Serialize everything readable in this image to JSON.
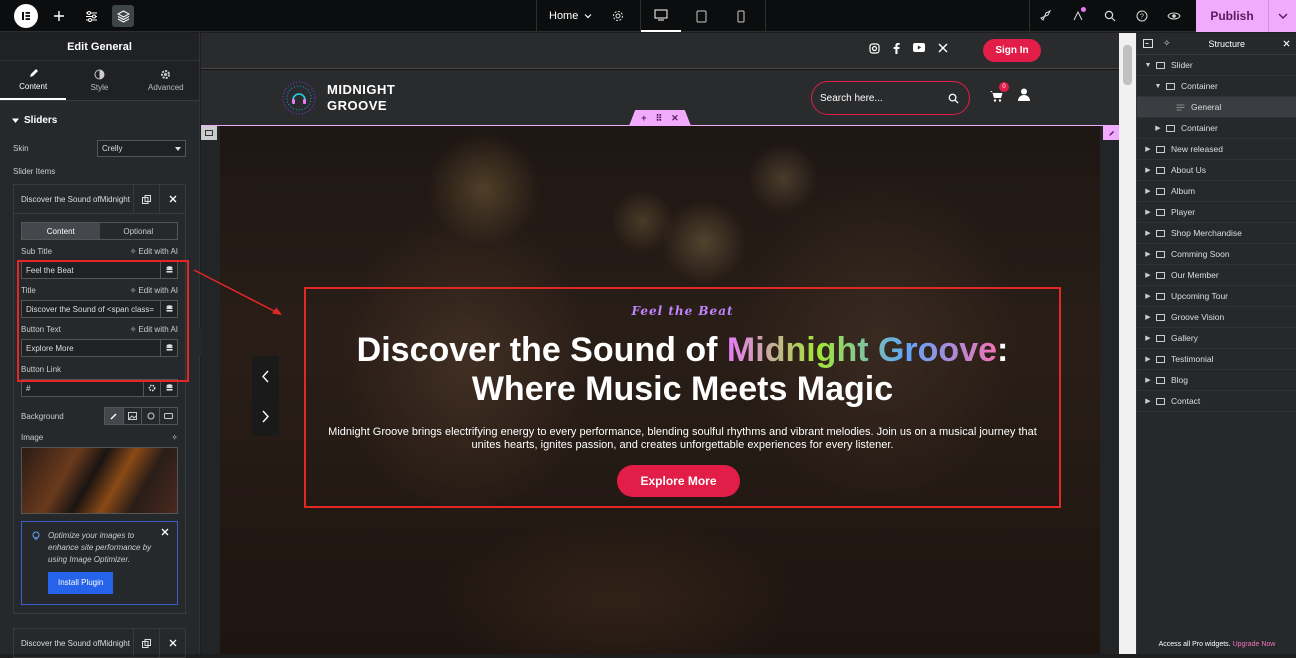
{
  "topbar": {
    "page_name": "Home",
    "publish_label": "Publish"
  },
  "left_panel": {
    "title": "Edit General",
    "tabs": [
      {
        "label": "Content"
      },
      {
        "label": "Style"
      },
      {
        "label": "Advanced"
      }
    ],
    "section_title": "Sliders",
    "skin_label": "Skin",
    "skin_value": "Crelly",
    "slider_items_label": "Slider Items",
    "item1_title": "Discover the Sound ofMidnight",
    "item_tabs": [
      "Content",
      "Optional"
    ],
    "fields": {
      "sub_title_label": "Sub Title",
      "sub_title_value": "Feel the Beat",
      "title_label": "Title",
      "title_value": "Discover the Sound of <span class=",
      "button_text_label": "Button Text",
      "button_text_value": "Explore More",
      "button_link_label": "Button Link",
      "button_link_value": "#",
      "edit_ai": "Edit with AI"
    },
    "background_label": "Background",
    "image_label": "Image",
    "notice_text": "Optimize your images to enhance site performance by using Image Optimizer.",
    "notice_button": "Install Plugin",
    "item2_title": "Discover the Sound ofMidnight"
  },
  "site": {
    "signin": "Sign In",
    "logo_line1": "MIDNIGHT",
    "logo_line2": "GROOVE",
    "search_placeholder": "Search here...",
    "cart_count": "0"
  },
  "hero": {
    "subtitle": "Feel the Beat",
    "title_part1": "Discover the Sound of ",
    "title_highlight": "Midnight Groove",
    "title_part2": ":",
    "title_line2": "Where Music Meets Magic",
    "description_line1": "Midnight Groove brings electrifying energy to every performance, blending soulful rhythms and vibrant melodies. Join us on a musical journey that",
    "description_line2": "unites hearts, ignites passion, and creates unforgettable experiences for every listener.",
    "button": "Explore More"
  },
  "structure": {
    "title": "Structure",
    "items": [
      {
        "label": "Slider",
        "depth": 0,
        "caret": "▼"
      },
      {
        "label": "Container",
        "depth": 1,
        "caret": "▼"
      },
      {
        "label": "General",
        "depth": 2,
        "caret": ""
      },
      {
        "label": "Container",
        "depth": 1,
        "caret": "▶"
      },
      {
        "label": "New released",
        "depth": 0,
        "caret": "▶"
      },
      {
        "label": "About Us",
        "depth": 0,
        "caret": "▶"
      },
      {
        "label": "Album",
        "depth": 0,
        "caret": "▶"
      },
      {
        "label": "Player",
        "depth": 0,
        "caret": "▶"
      },
      {
        "label": "Shop Merchandise",
        "depth": 0,
        "caret": "▶"
      },
      {
        "label": "Comming Soon",
        "depth": 0,
        "caret": "▶"
      },
      {
        "label": "Our Member",
        "depth": 0,
        "caret": "▶"
      },
      {
        "label": "Upcoming Tour",
        "depth": 0,
        "caret": "▶"
      },
      {
        "label": "Groove Vision",
        "depth": 0,
        "caret": "▶"
      },
      {
        "label": "Gallery",
        "depth": 0,
        "caret": "▶"
      },
      {
        "label": "Testimonial",
        "depth": 0,
        "caret": "▶"
      },
      {
        "label": "Blog",
        "depth": 0,
        "caret": "▶"
      },
      {
        "label": "Contact",
        "depth": 0,
        "caret": "▶"
      }
    ],
    "footer_text": "Access all Pro widgets.",
    "footer_link": "Upgrade Now"
  },
  "colors": {
    "accent": "#e11d48",
    "publish": "#f0abfc",
    "annotation": "#e32626"
  }
}
